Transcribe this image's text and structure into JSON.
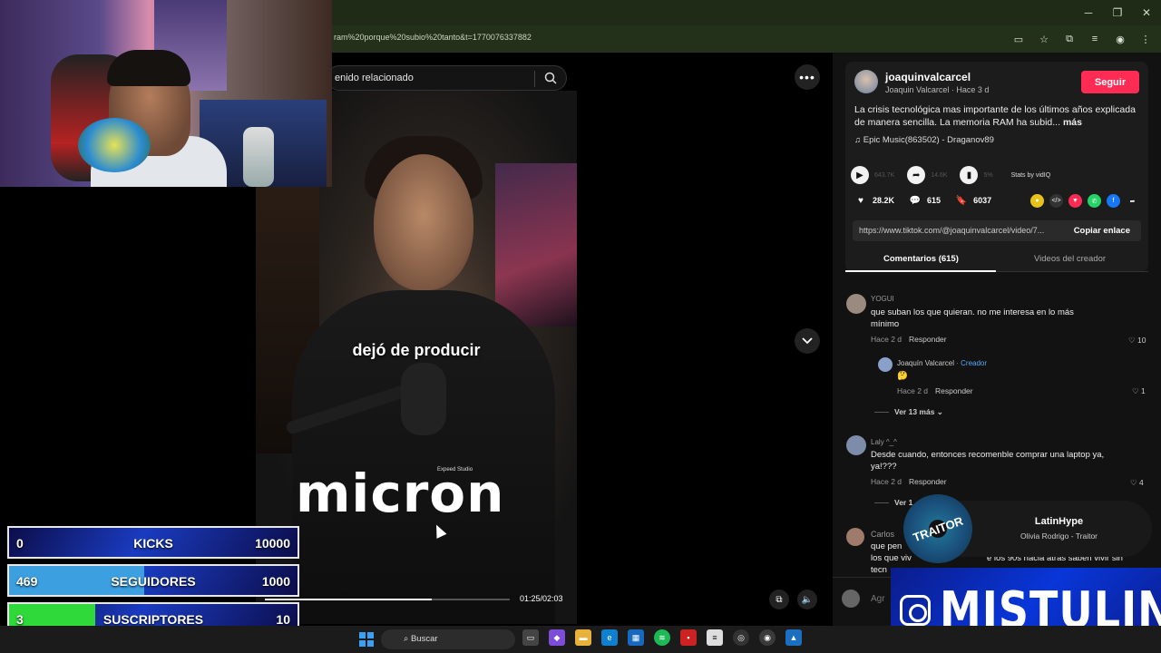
{
  "browser": {
    "url": "ram%20porque%20subio%20tanto&t=1770076337882"
  },
  "search": {
    "text": "enido relacionado"
  },
  "video": {
    "caption": "dejó de producir",
    "brand": "micron",
    "brand_small": "Expeed Studio",
    "time": "01:25/02:03",
    "progress": 0.68
  },
  "creator": {
    "username": "joaquinvalcarcel",
    "subtitle": "Joaquin Valcarcel · Hace 3 d",
    "follow_label": "Seguir",
    "description": "La crisis tecnológica mas importante de los últimos años explicada de manera sencilla. La memoria RAM ha subid...",
    "more_label": "más",
    "music": "Epic Music(863502) - Draganov89"
  },
  "stats": {
    "views": "643.7K",
    "shares_faint": "14.6K",
    "percent": "5%",
    "stats_by": "Stats by vidIQ",
    "likes": "28.2K",
    "comments": "615",
    "saves": "6037"
  },
  "link": {
    "url": "https://www.tiktok.com/@joaquinvalcarcel/video/7...",
    "copy_label": "Copiar enlace"
  },
  "tabs": {
    "comments": "Comentarios (615)",
    "creator_videos": "Videos del creador"
  },
  "comments": [
    {
      "user": "YOGUI",
      "text": "que suban los que quieran. no me interesa en lo más mínimo",
      "time": "Hace 2 d",
      "reply": "Responder",
      "likes": "10"
    },
    {
      "user": "Joaquín Valcarcel",
      "creator_tag": "· Creador",
      "text": "🤔",
      "time": "Hace 2 d",
      "reply": "Responder",
      "likes": "1"
    },
    {
      "more": "Ver 13 más"
    },
    {
      "user": "Laly ^_^",
      "text": "Desde cuando, entonces recomenble comprar una laptop ya, ya!???",
      "time": "Hace 2 d",
      "reply": "Responder",
      "likes": "4"
    },
    {
      "more": "Ver 1"
    },
    {
      "user": "Carlos",
      "text": "que pen",
      "text2": "los que viv",
      "text2b": "e los 90s hacia atrás saben vivir sin",
      "text3": "tecn"
    }
  ],
  "comment_input": {
    "placeholder": "Agr"
  },
  "goals": [
    {
      "left": "0",
      "label": "KICKS",
      "right": "10000",
      "fill": 0,
      "color": "#3b9fe0"
    },
    {
      "left": "469",
      "label": "SEGUIDORES",
      "right": "1000",
      "fill": 0.469,
      "color": "#3b9fe0"
    },
    {
      "left": "3",
      "label": "SUSCRIPTORES",
      "right": "10",
      "fill": 0.3,
      "color": "#2fd93a"
    }
  ],
  "now_playing": {
    "disc_text": "TRAITOR",
    "title": "LatinHype",
    "subtitle": "Olivia Rodrigo - Traitor"
  },
  "instagram": {
    "name": "MISTULINO"
  },
  "taskbar": {
    "search_label": "Buscar"
  }
}
